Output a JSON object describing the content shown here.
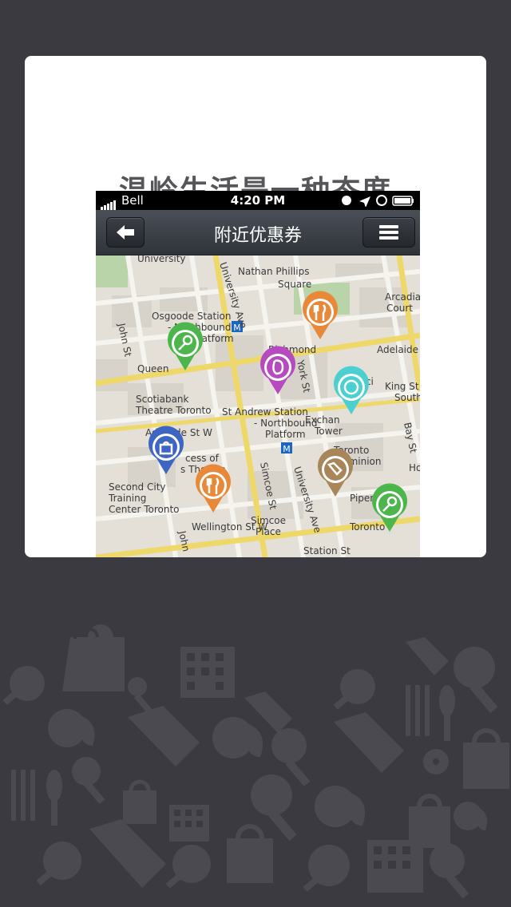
{
  "card": {
    "title": "温岭生活是一种态度"
  },
  "phone": {
    "status": {
      "carrier": "Bell",
      "time": "4:20 PM"
    },
    "navbar": {
      "title": "附近优惠券"
    }
  },
  "map": {
    "labels": {
      "university": "University",
      "university_ave": "University Ave",
      "nathan_phillips": "Nathan Phillips",
      "square": "Square",
      "arcadia": "Arcadia",
      "court": "Court",
      "osgoode": "Osgoode Station",
      "northbound": "- Northbound",
      "platform": "Platform",
      "john_st": "John St",
      "richmond": "Richmond",
      "queen": "Queen",
      "york_st": "York St",
      "adelaide": "Adelaide S",
      "financial": "Financi",
      "king_st": "King St",
      "south": "South",
      "scotiabank": "Scotiabank",
      "theatre_toronto": "Theatre Toronto",
      "st_andrew": "St Andrew Station",
      "northbound2": "- Northbound",
      "platform2": "Platform",
      "exchange": "Exchan",
      "tower": "Tower",
      "bay_st": "Bay St",
      "adelaide_w": "Adelaide St W",
      "princess": "cess of",
      "wales_theatre": "s Theatre",
      "toronto": "Toronto",
      "dominion": "Dominion",
      "second_city": "Second City",
      "training": "Training",
      "center_toronto": "Center Toronto",
      "simcoe_st": "Simcoe St",
      "university_ave2": "University Ave",
      "piper_st": "Piper St",
      "wellington": "Wellington St W",
      "simcoe_place": "Simcoe",
      "place": "Place",
      "toronto2": "Toronto",
      "station_st": "Station St",
      "john_st2": "John",
      "ho": "Ho"
    },
    "pins": [
      {
        "name": "restaurant-pin",
        "color": "#e8893a",
        "icon": "fork-knife-icon"
      },
      {
        "name": "karaoke-pin",
        "color": "#4cb54b",
        "icon": "microphone-icon"
      },
      {
        "name": "salon-pin",
        "color": "#b64bbf",
        "icon": "hair-icon"
      },
      {
        "name": "cd-pin",
        "color": "#4bcfd0",
        "icon": "disc-icon"
      },
      {
        "name": "shopping-pin",
        "color": "#3d66c4",
        "icon": "shopping-bag-icon"
      },
      {
        "name": "restaurant-pin-2",
        "color": "#e8893a",
        "icon": "fork-knife-icon"
      },
      {
        "name": "tag-pin",
        "color": "#a8865a",
        "icon": "price-tag-icon"
      },
      {
        "name": "karaoke-pin-2",
        "color": "#4cb54b",
        "icon": "microphone-icon"
      }
    ]
  }
}
